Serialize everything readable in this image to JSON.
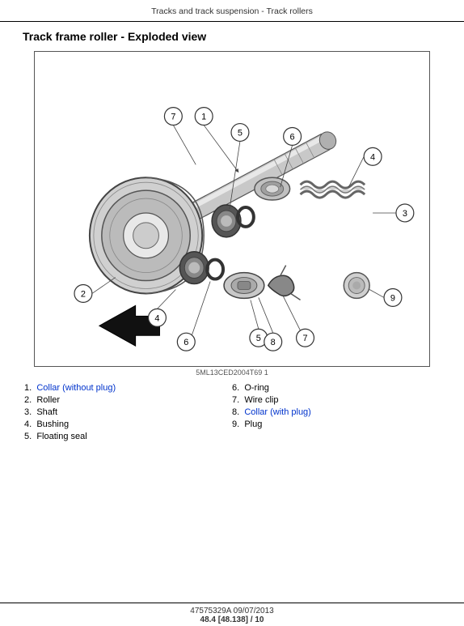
{
  "header": {
    "title": "Tracks and track suspension - Track rollers"
  },
  "section": {
    "title": "Track frame roller - Exploded view"
  },
  "diagram": {
    "caption": "5ML13CED2004T69   1"
  },
  "parts": {
    "left": [
      {
        "num": "1.",
        "label": "Collar (without plug)",
        "blue": true
      },
      {
        "num": "2.",
        "label": "Roller",
        "blue": false
      },
      {
        "num": "3.",
        "label": "Shaft",
        "blue": false
      },
      {
        "num": "4.",
        "label": "Bushing",
        "blue": false
      },
      {
        "num": "5.",
        "label": "Floating seal",
        "blue": false
      }
    ],
    "right": [
      {
        "num": "6.",
        "label": "O-ring",
        "blue": false
      },
      {
        "num": "7.",
        "label": "Wire clip",
        "blue": false
      },
      {
        "num": "8.",
        "label": "Collar (with plug)",
        "blue": true
      },
      {
        "num": "9.",
        "label": "Plug",
        "blue": false
      }
    ]
  },
  "footer": {
    "part_number": "47575329A 09/07/2013",
    "page": "48.4 [48.138] / 10"
  }
}
